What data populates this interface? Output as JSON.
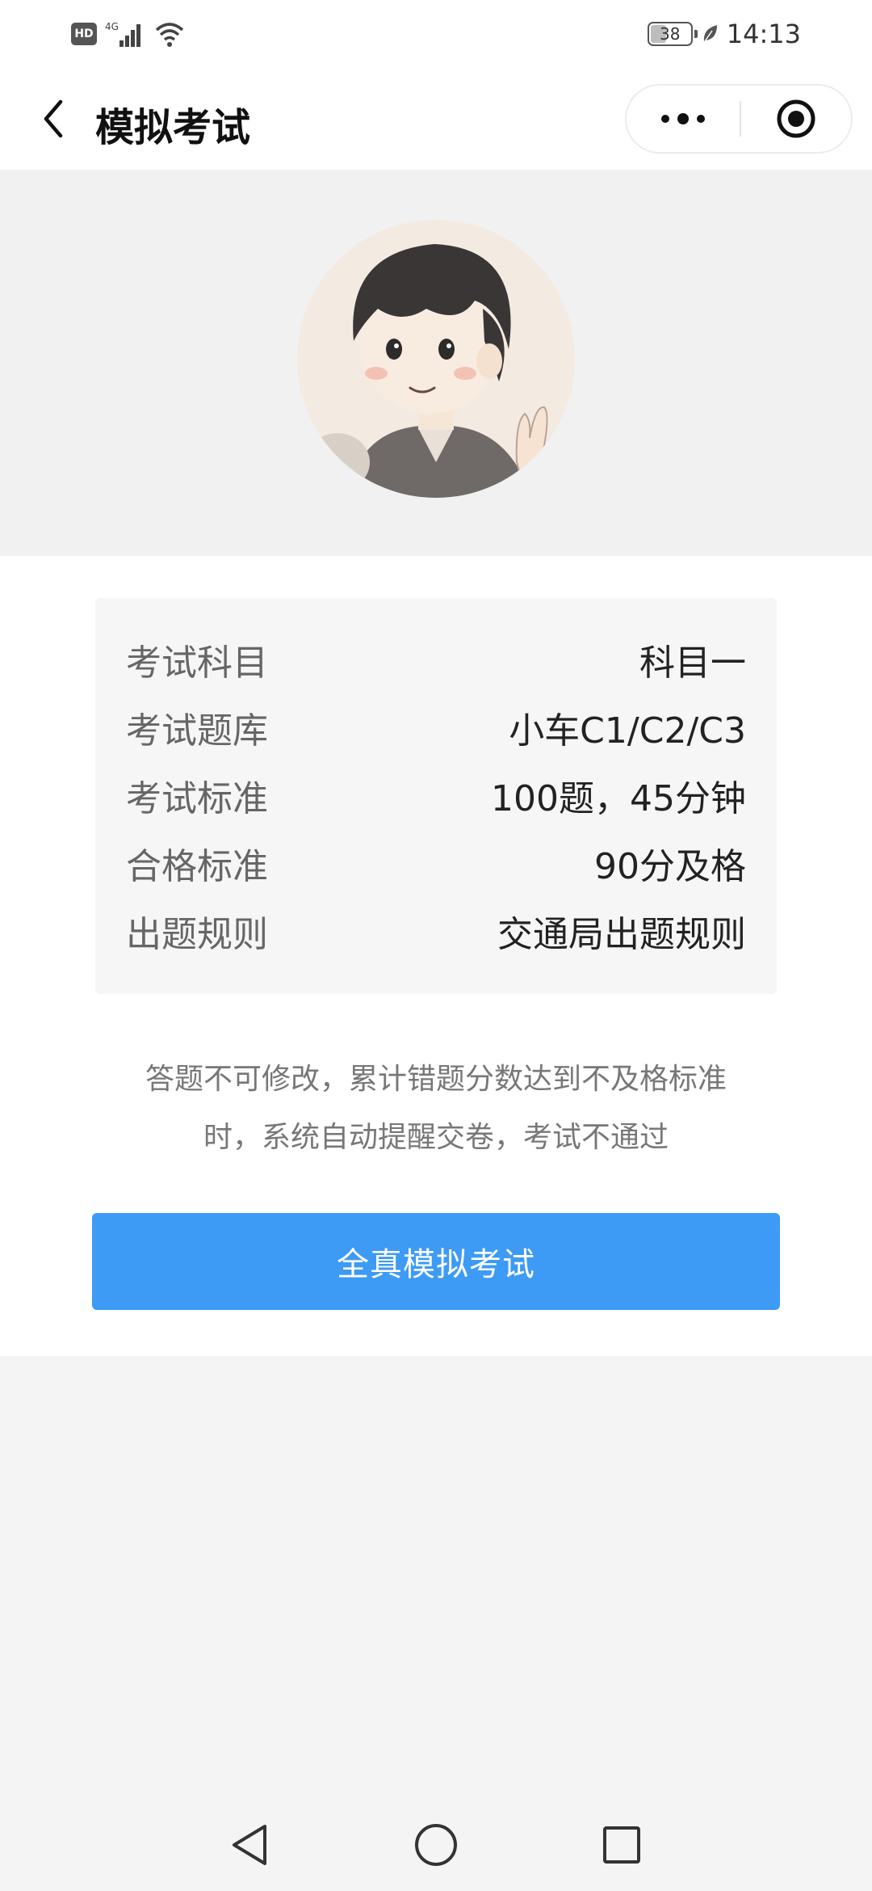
{
  "status_bar": {
    "hd_label": "HD",
    "network": "4G",
    "battery": "38",
    "time": "14:13"
  },
  "nav": {
    "title": "模拟考试",
    "icons": [
      "back-arrow-icon",
      "more-dots-icon",
      "close-target-icon"
    ]
  },
  "exam_info": [
    {
      "label": "考试科目",
      "value": "科目一"
    },
    {
      "label": "考试题库",
      "value": "小车C1/C2/C3"
    },
    {
      "label": "考试标准",
      "value": "100题，45分钟"
    },
    {
      "label": "合格标准",
      "value": "90分及格"
    },
    {
      "label": "出题规则",
      "value": "交通局出题规则"
    }
  ],
  "notice": {
    "line1": "答题不可修改，累计错题分数达到不及格标准",
    "line2": "时，系统自动提醒交卷，考试不通过"
  },
  "start_button": "全真模拟考试",
  "colors": {
    "primary": "#3d9af5",
    "card_bg": "#f6f6f6",
    "page_bg": "#f4f4f5"
  }
}
